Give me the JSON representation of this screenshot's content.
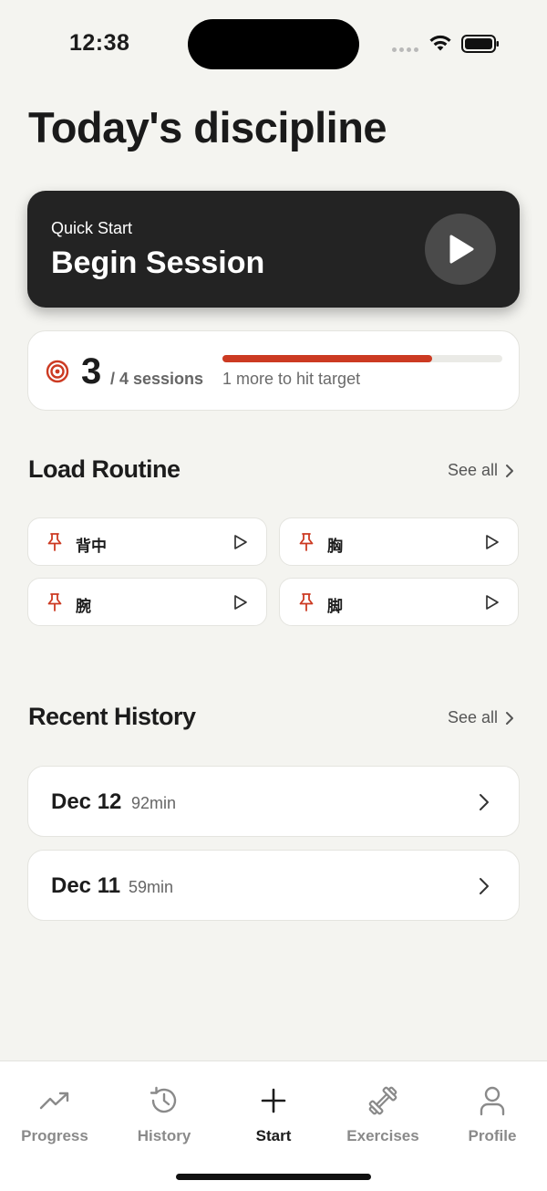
{
  "status": {
    "time": "12:38"
  },
  "page": {
    "title": "Today's discipline"
  },
  "quick_start": {
    "label": "Quick Start",
    "title": "Begin Session"
  },
  "progress": {
    "count": "3",
    "total": "/ 4 sessions",
    "hint": "1 more to hit target",
    "fraction": 0.75,
    "accent": "#cc3a22"
  },
  "routines": {
    "title": "Load Routine",
    "see_all": "See all",
    "items": [
      {
        "name": "背中"
      },
      {
        "name": "胸"
      },
      {
        "name": "腕"
      },
      {
        "name": "脚"
      }
    ]
  },
  "history": {
    "title": "Recent History",
    "see_all": "See all",
    "items": [
      {
        "date": "Dec 12",
        "duration": "92min"
      },
      {
        "date": "Dec 11",
        "duration": "59min"
      }
    ]
  },
  "tabs": [
    {
      "label": "Progress",
      "icon": "trending-up-icon",
      "active": false
    },
    {
      "label": "History",
      "icon": "history-icon",
      "active": false
    },
    {
      "label": "Start",
      "icon": "plus-icon",
      "active": true
    },
    {
      "label": "Exercises",
      "icon": "dumbbell-icon",
      "active": false
    },
    {
      "label": "Profile",
      "icon": "user-icon",
      "active": false
    }
  ]
}
